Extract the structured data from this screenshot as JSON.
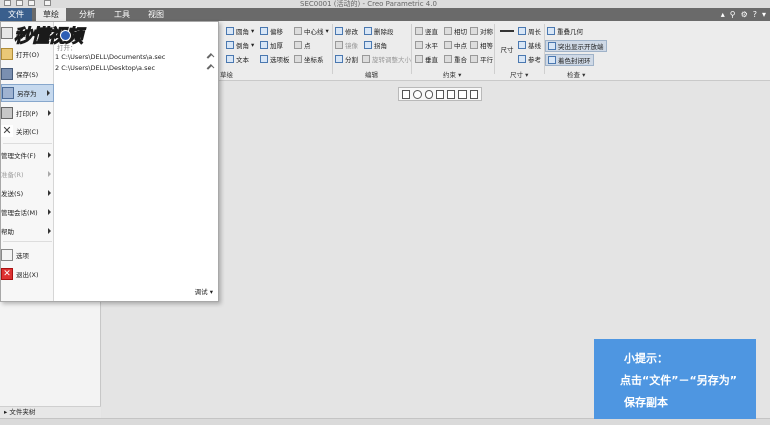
{
  "window": {
    "title": "SEC0001 (活动的) - Creo Parametric 4.0"
  },
  "tabs": {
    "file": "文件",
    "sketch": "草绘",
    "analysis": "分析",
    "tools": "工具",
    "view": "视图"
  },
  "ribbon": {
    "row1": [
      "圆角",
      "偏移",
      "中心线",
      "修改",
      "删除段",
      "竖直",
      "相切",
      "对称",
      "周长",
      "重叠几何"
    ],
    "row2": [
      "倒角",
      "加厚",
      "点",
      "镜像",
      "拐角",
      "水平",
      "中点",
      "相等",
      "基线",
      "突出显示开放端"
    ],
    "row3": [
      "文本",
      "选项板",
      "坐标系",
      "分割",
      "旋转调整大小",
      "垂直",
      "重合",
      "平行",
      "参考",
      "着色封闭环"
    ],
    "dimension": "尺寸",
    "groups": {
      "sketch": "草绘",
      "edit": "编辑",
      "constrain": "约束",
      "dimension": "尺寸",
      "inspect": "检查"
    }
  },
  "file_menu": {
    "items": {
      "new": "新建",
      "open": "打开(O)",
      "save": "保存(S)",
      "save_as": "另存为",
      "print": "打印(P)",
      "close": "关闭(C)",
      "manage_file": "管理文件(F)",
      "prepare": "准备(R)",
      "send": "发送(S)",
      "manage_session": "管理会话(M)",
      "help": "帮助",
      "options": "选项",
      "exit": "退出(X)"
    },
    "recent_header": "打开：",
    "recent_files": [
      "1 C:\\Users\\DELL\\Documents\\a.sec",
      "2 C:\\Users\\DELL\\Desktop\\a.sec"
    ],
    "debug": "调试"
  },
  "left_panel": {
    "bottom_label": "文件夹树"
  },
  "watermark": {
    "text": "秒懂视频"
  },
  "tip": {
    "line1": "小提示：",
    "line2": "点击“文件”－“另存为”",
    "line3": "保存副本"
  }
}
